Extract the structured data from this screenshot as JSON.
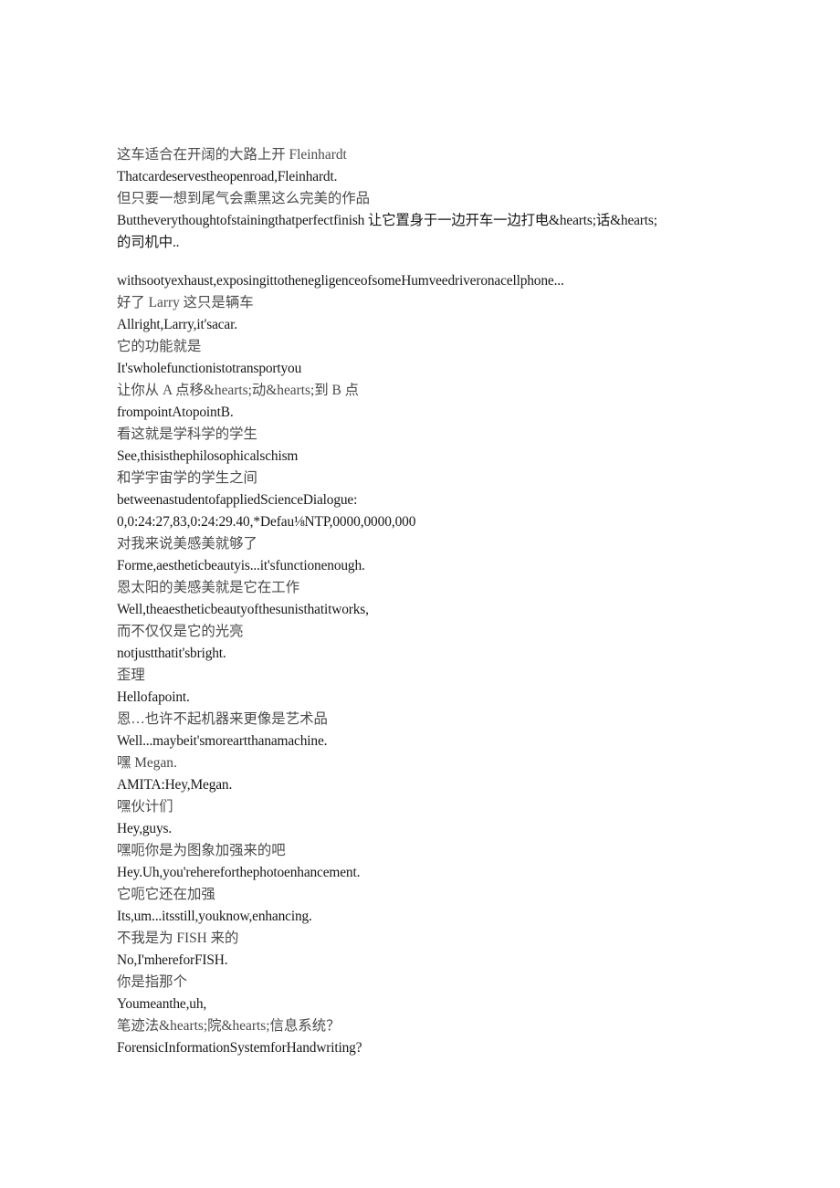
{
  "document": {
    "page_background": "#ffffff",
    "text_color": "#231f20",
    "zh_text_color": "#4a4a4c",
    "en_text_color": "#1a1718",
    "lines": [
      {
        "id": "l01",
        "lang": "zh",
        "text": "这车适合在开阔的大路上开 Fleinhardt"
      },
      {
        "id": "l02",
        "lang": "en",
        "text": "Thatcardeservestheopenroad,Fleinhardt."
      },
      {
        "id": "l03",
        "lang": "zh",
        "text": "但只要一想到尾气会熏黑这么完美的作品"
      },
      {
        "id": "l04",
        "lang": "mixed",
        "text": "Buttheverythoughtofstainingthatperfectfinish 让它置身于一边开车一边打电&hearts;话&hearts;的司机中.."
      },
      {
        "id": "l05",
        "lang": "en",
        "text": "withsootyexhaust,exposingittothenegligenceofsomeHumveedriveronacellphone..."
      },
      {
        "id": "l06",
        "lang": "zh",
        "text": "好了 Larry 这只是辆车"
      },
      {
        "id": "l07",
        "lang": "en",
        "text": "Allright,Larry,it'sacar."
      },
      {
        "id": "l08",
        "lang": "zh",
        "text": "它的功能就是"
      },
      {
        "id": "l09",
        "lang": "en",
        "text": "It'swholefunctionistotransportyou"
      },
      {
        "id": "l10",
        "lang": "mixed",
        "text": "让你从 A 点移&hearts;动&hearts;到 B 点"
      },
      {
        "id": "l11",
        "lang": "en",
        "text": "frompointAtopointB."
      },
      {
        "id": "l12",
        "lang": "zh",
        "text": "看这就是学科学的学生"
      },
      {
        "id": "l13",
        "lang": "en",
        "text": "See,thisisthephilosophicalschism"
      },
      {
        "id": "l14",
        "lang": "zh",
        "text": "和学宇宙学的学生之间"
      },
      {
        "id": "l15",
        "lang": "en",
        "text": "betweenastudentofappliedScienceDialogue:"
      },
      {
        "id": "l16",
        "lang": "timecode",
        "text": "0,0:24:27,83,0:24:29.40,*Defau⅛NTP,0000,0000,000"
      },
      {
        "id": "l17",
        "lang": "zh",
        "text": "对我来说美感美就够了"
      },
      {
        "id": "l18",
        "lang": "en",
        "text": "Forme,aestheticbeautyis...it'sfunctionenough."
      },
      {
        "id": "l19",
        "lang": "zh",
        "text": "恩太阳的美感美就是它在工作"
      },
      {
        "id": "l20",
        "lang": "en",
        "text": "Well,theaestheticbeautyofthesunisthatitworks,"
      },
      {
        "id": "l21",
        "lang": "zh",
        "text": "而不仅仅是它的光亮"
      },
      {
        "id": "l22",
        "lang": "en",
        "text": "notjustthatit'sbright."
      },
      {
        "id": "l23",
        "lang": "zh",
        "text": "歪理"
      },
      {
        "id": "l24",
        "lang": "en",
        "text": "Hellofapoint."
      },
      {
        "id": "l25",
        "lang": "zh",
        "text": "恩…也许不起机器来更像是艺术品"
      },
      {
        "id": "l26",
        "lang": "en",
        "text": "Well...maybeit'smoreartthanamachine."
      },
      {
        "id": "l27",
        "lang": "mixed",
        "text": "嘿 Megan."
      },
      {
        "id": "l28",
        "lang": "en",
        "text": "AMITA:Hey,Megan."
      },
      {
        "id": "l29",
        "lang": "zh",
        "text": "嘿伙计们"
      },
      {
        "id": "l30",
        "lang": "en",
        "text": "Hey,guys."
      },
      {
        "id": "l31",
        "lang": "zh",
        "text": "嘿呃你是为图象加强来的吧"
      },
      {
        "id": "l32",
        "lang": "en",
        "text": "Hey.Uh,you'rehereforthephotoenhancement."
      },
      {
        "id": "l33",
        "lang": "zh",
        "text": "它呃它还在加强"
      },
      {
        "id": "l34",
        "lang": "en",
        "text": "Its,um...itsstill,youknow,enhancing."
      },
      {
        "id": "l35",
        "lang": "mixed",
        "text": "不我是为 FISH 来的"
      },
      {
        "id": "l36",
        "lang": "en",
        "text": "No,I'mhereforFISH."
      },
      {
        "id": "l37",
        "lang": "zh",
        "text": "你是指那个"
      },
      {
        "id": "l38",
        "lang": "en",
        "text": "Youmeanthe,uh,"
      },
      {
        "id": "l39",
        "lang": "mixed",
        "text": "笔迹法&hearts;院&hearts;信息系统？"
      },
      {
        "id": "l40",
        "lang": "en",
        "text": "ForensicInformationSystemforHandwriting?"
      }
    ]
  }
}
